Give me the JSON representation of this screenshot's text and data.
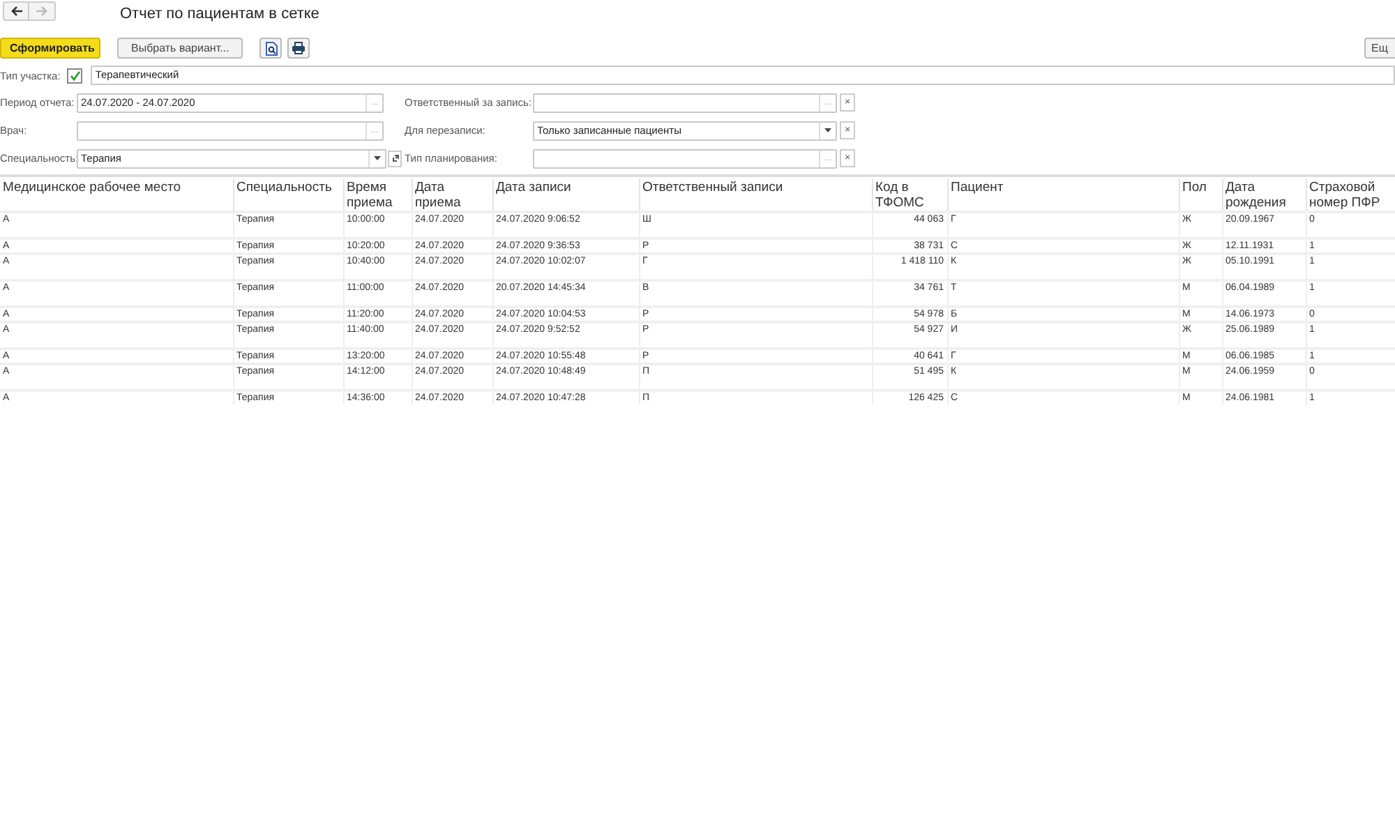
{
  "nav": [
    {
      "kind": "back",
      "disabled": false
    },
    {
      "kind": "forward",
      "disabled": true
    }
  ],
  "title": "Отчет по пациентам в сетке",
  "toolbar": {
    "buttons": [
      {
        "kind": "primary",
        "label": "Сформировать"
      },
      {
        "kind": "default",
        "label": "Выбрать вариант..."
      }
    ],
    "more_button": "Ещ"
  },
  "filter_top": {
    "label": "Тип участка:",
    "checked": true,
    "value": "Терапевтический"
  },
  "filters_left": [
    {
      "label": "Период отчета:",
      "value": "24.07.2020 - 24.07.2020",
      "kind": "choice",
      "choice_button": "..."
    },
    {
      "label": "Врач:",
      "kind": "choice",
      "choice_button": "..."
    },
    {
      "label": "Специальность:",
      "value": "Терапия",
      "kind": "dropdown_link"
    }
  ],
  "filters_right": [
    {
      "label": "Ответственный за запись:",
      "kind": "choice",
      "choice_button": "...",
      "clear_button": "×"
    },
    {
      "label": "Для перезаписи:",
      "value": "Только записанные пациенты",
      "kind": "dropdown",
      "clear_button": "×"
    },
    {
      "label": "Тип планирования:",
      "kind": "choice",
      "choice_button": "...",
      "clear_button": "×"
    }
  ],
  "table": {
    "columns": [
      "Медицинское рабочее место",
      "Специальность",
      "Время приема",
      "Дата приема",
      "Дата записи",
      "Ответственный записи",
      "Код в ТФОМС",
      "Пациент",
      "Пол",
      "Дата рождения",
      "Страховой номер ПФР"
    ],
    "rows": [
      {
        "tall": true,
        "cells": [
          "А",
          "Терапия",
          "10:00:00",
          "24.07.2020",
          "24.07.2020 9:06:52",
          "Ш",
          "44 063",
          "Г",
          "Ж",
          "20.09.1967",
          "0"
        ]
      },
      {
        "tall": false,
        "cells": [
          "А",
          "Терапия",
          "10:20:00",
          "24.07.2020",
          "24.07.2020 9:36:53",
          "Р",
          "38 731",
          "С",
          "Ж",
          "12.11.1931",
          "1"
        ]
      },
      {
        "tall": true,
        "cells": [
          "А",
          "Терапия",
          "10:40:00",
          "24.07.2020",
          "24.07.2020 10:02:07",
          "Г",
          "1 418 110",
          "К",
          "Ж",
          "05.10.1991",
          "1"
        ]
      },
      {
        "tall": true,
        "cells": [
          "А",
          "Терапия",
          "11:00:00",
          "24.07.2020",
          "20.07.2020 14:45:34",
          "В",
          "34 761",
          "Т",
          "М",
          "06.04.1989",
          "1"
        ]
      },
      {
        "tall": false,
        "cells": [
          "А",
          "Терапия",
          "11:20:00",
          "24.07.2020",
          "24.07.2020 10:04:53",
          "Р",
          "54 978",
          "Б",
          "М",
          "14.06.1973",
          "0"
        ]
      },
      {
        "tall": true,
        "cells": [
          "А",
          "Терапия",
          "11:40:00",
          "24.07.2020",
          "24.07.2020 9:52:52",
          "Р",
          "54 927",
          "И",
          "Ж",
          "25.06.1989",
          "1"
        ]
      },
      {
        "tall": false,
        "cells": [
          "А",
          "Терапия",
          "13:20:00",
          "24.07.2020",
          "24.07.2020 10:55:48",
          "Р",
          "40 641",
          "Г",
          "М",
          "06.06.1985",
          "1"
        ]
      },
      {
        "tall": true,
        "cells": [
          "А",
          "Терапия",
          "14:12:00",
          "24.07.2020",
          "24.07.2020 10:48:49",
          "П",
          "51 495",
          "К",
          "М",
          "24.06.1959",
          "0"
        ]
      },
      {
        "tall": false,
        "cells": [
          "А",
          "Терапия",
          "14:36:00",
          "24.07.2020",
          "24.07.2020 10:47:28",
          "П",
          "126 425",
          "С",
          "М",
          "24.06.1981",
          "1"
        ]
      }
    ]
  }
}
